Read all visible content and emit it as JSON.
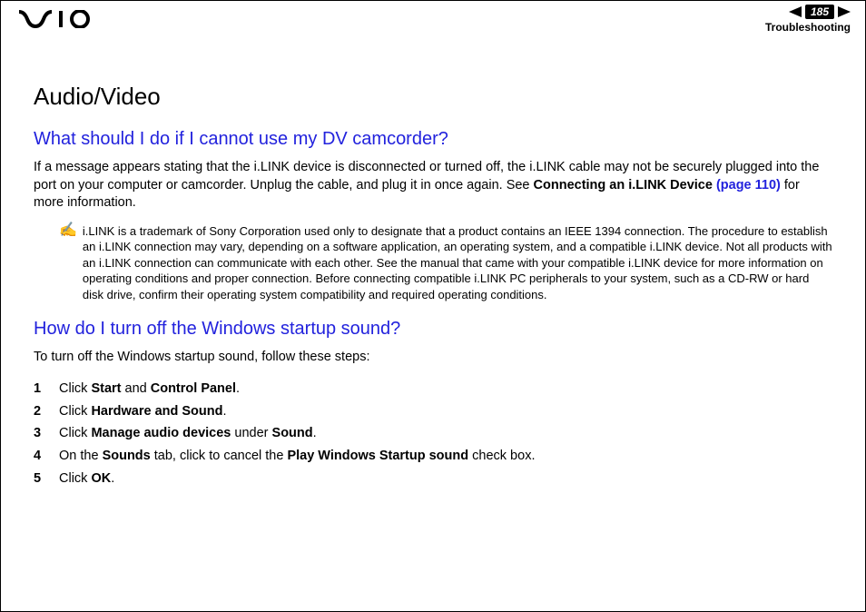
{
  "header": {
    "page_number": "185",
    "section": "Troubleshooting"
  },
  "content": {
    "title": "Audio/Video",
    "q1": {
      "heading": "What should I do if I cannot use my DV camcorder?",
      "para_pre": "If a message appears stating that the i.LINK device is disconnected or turned off, the i.LINK cable may not be securely plugged into the port on your computer or camcorder. Unplug the cable, and plug it in once again. See ",
      "para_bold": "Connecting an i.LINK Device ",
      "para_link": "(page 110)",
      "para_post": " for more information.",
      "note_icon": "✍",
      "note": "i.LINK is a trademark of Sony Corporation used only to designate that a product contains an IEEE 1394 connection. The procedure to establish an i.LINK connection may vary, depending on a software application, an operating system, and a compatible i.LINK device. Not all products with an i.LINK connection can communicate with each other. See the manual that came with your compatible i.LINK device for more information on operating conditions and proper connection. Before connecting compatible i.LINK PC peripherals to your system, such as a CD-RW or hard disk drive, confirm their operating system compatibility and required operating conditions."
    },
    "q2": {
      "heading": "How do I turn off the Windows startup sound?",
      "intro": "To turn off the Windows startup sound, follow these steps:",
      "steps": [
        {
          "n": "1",
          "pre": "Click ",
          "b1": "Start",
          "mid": " and ",
          "b2": "Control Panel",
          "post": "."
        },
        {
          "n": "2",
          "pre": "Click ",
          "b1": "Hardware and Sound",
          "mid": "",
          "b2": "",
          "post": "."
        },
        {
          "n": "3",
          "pre": "Click ",
          "b1": "Manage audio devices",
          "mid": " under ",
          "b2": "Sound",
          "post": "."
        },
        {
          "n": "4",
          "pre": "On the ",
          "b1": "Sounds",
          "mid": " tab, click to cancel the ",
          "b2": "Play Windows Startup sound",
          "post": " check box."
        },
        {
          "n": "5",
          "pre": "Click ",
          "b1": "OK",
          "mid": "",
          "b2": "",
          "post": "."
        }
      ]
    }
  }
}
